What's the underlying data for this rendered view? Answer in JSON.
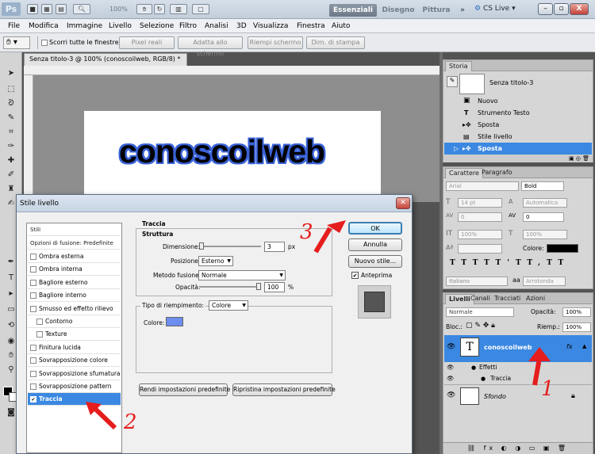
{
  "app": {
    "logo": "Ps",
    "zoom": "100%",
    "workspaces": [
      "Essenziali",
      "Disegno",
      "Pittura"
    ],
    "more": "»",
    "cslive": "CS Live"
  },
  "menu": [
    "File",
    "Modifica",
    "Immagine",
    "Livello",
    "Selezione",
    "Filtro",
    "Analisi",
    "3D",
    "Visualizza",
    "Finestra",
    "Aiuto"
  ],
  "options": {
    "scroll_all": "Scorri tutte le finestre",
    "buttons": [
      "Pixel reali",
      "Adatta allo schermo",
      "Riempi schermo",
      "Dim. di stampa"
    ]
  },
  "document": {
    "tab": "Senza titolo-3 @ 100% (conoscoilweb, RGB/8) *",
    "close": "×",
    "text": "conoscoilweb"
  },
  "history": {
    "tab": "Storia",
    "snapshot": "Senza titolo-3",
    "items": [
      "Nuovo",
      "Strumento Testo",
      "Sposta",
      "Stile livello",
      "Sposta"
    ]
  },
  "character": {
    "tabs": [
      "Carattere",
      "Paragrafo"
    ],
    "font": "Arial",
    "style": "Bold",
    "size": "14 pt",
    "leading": "Automatica",
    "kerning": "0",
    "tracking": "0",
    "vscale": "100%",
    "hscale": "100%",
    "color_label": "Colore:",
    "language": "Italiano",
    "aa": "Arrotonda",
    "aa_glyph": "aa"
  },
  "layers": {
    "tabs": [
      "Livelli",
      "Canali",
      "Tracciati",
      "Azioni"
    ],
    "mode": "Normale",
    "opacity_label": "Opacità:",
    "opacity": "100%",
    "lock_label": "Bloc.:",
    "fill_label": "Riemp.:",
    "fill": "100%",
    "layer_name": "conoscoilweb",
    "fx": "fx",
    "effects": "Effetti",
    "effect_item": "Traccia",
    "bg_name": "Sfondo"
  },
  "dialog": {
    "title": "Stile livello",
    "close": "✕",
    "list_header": "Stili",
    "blend_header": "Opzioni di fusione: Predefinite",
    "styles": [
      "Ombra esterna",
      "Ombra interna",
      "Bagliore esterno",
      "Bagliore interno",
      "Smusso ed effetto rilievo",
      "Contorno",
      "Texture",
      "Finitura lucida",
      "Sovrapposizione colore",
      "Sovrapposizione sfumatura",
      "Sovrapposizione pattern",
      "Traccia"
    ],
    "section": "Traccia",
    "structure": "Struttura",
    "size_label": "Dimensione:",
    "size_value": "3",
    "size_unit": "px",
    "position_label": "Posizione:",
    "position_value": "Esterno",
    "blend_label": "Metodo fusione:",
    "blend_value": "Normale",
    "opacity_label": "Opacità:",
    "opacity_value": "100",
    "opacity_unit": "%",
    "fill_type_label": "Tipo di riempimento:",
    "fill_type_value": "Colore",
    "color_label": "Colore:",
    "btn_defaults": "Rendi impostazioni predefinite",
    "btn_reset": "Ripristina impostazioni predefinite",
    "ok": "OK",
    "cancel": "Annulla",
    "new_style": "Nuovo stile...",
    "preview": "Anteprima"
  },
  "annotations": {
    "one": "1",
    "two": "2",
    "three": "3"
  },
  "colors": {
    "stroke": "#3a63d8",
    "selection": "#3b88e2",
    "annotation": "#e51d1d",
    "fill_swatch": "#6d8ef0"
  }
}
